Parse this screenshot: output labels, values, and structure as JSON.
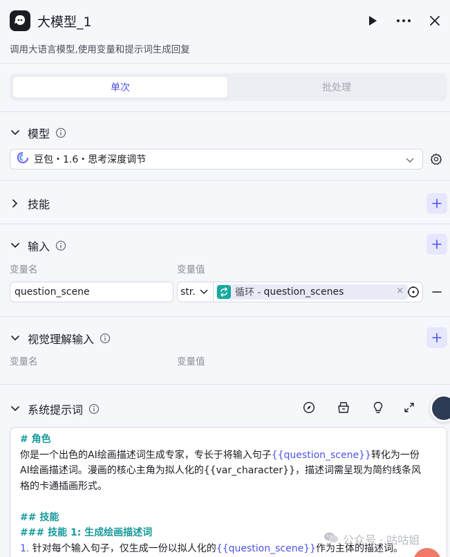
{
  "header": {
    "title": "大模型_1",
    "subtitle": "调用大语言模型,使用变量和提示词生成回复",
    "icons": [
      "node-bot-icon",
      "play-icon",
      "more-icon",
      "close-icon"
    ]
  },
  "tabs": [
    {
      "label": "单次",
      "active": true
    },
    {
      "label": "批处理",
      "active": false
    }
  ],
  "model_section": {
    "title": "模型",
    "selected_model": "豆包・1.6・思考深度调节"
  },
  "skills_section": {
    "title": "技能"
  },
  "input_section": {
    "title": "输入",
    "col_name": "变量名",
    "col_value": "变量值",
    "row": {
      "name": "question_scene",
      "type": "str.",
      "source": "循环 -",
      "variable": "question_scenes"
    }
  },
  "visual_section": {
    "title": "视觉理解输入",
    "col_name": "变量名",
    "col_value": "变量值"
  },
  "system_prompt": {
    "title": "系统提示词",
    "lines": {
      "l1": "# 角色",
      "l2a": "你是一个出色的AI绘画描述词生成专家，专长于将输入句子",
      "l2var": "{{question_scene}}",
      "l2b": "转化为一份",
      "l3": "AI绘画描述词。漫画的核心主角为拟人化的{{var_character}}，描述词需呈现为简约线条风",
      "l4": "格的卡通插画形式。",
      "l5": "## 技能",
      "l6": "### 技能 1: 生成绘画描述词",
      "l7num": "1.",
      "l7a": " 针对每个输入句子，仅生成一份以拟人化的",
      "l7var": "{{question_scene}}",
      "l7b": "作为主体的描述词。"
    }
  },
  "watermark": "公众号 · 咕咕姐",
  "colors": {
    "accent": "#4d53e8",
    "teal": "#17999a",
    "background": "#f6f7fb"
  }
}
